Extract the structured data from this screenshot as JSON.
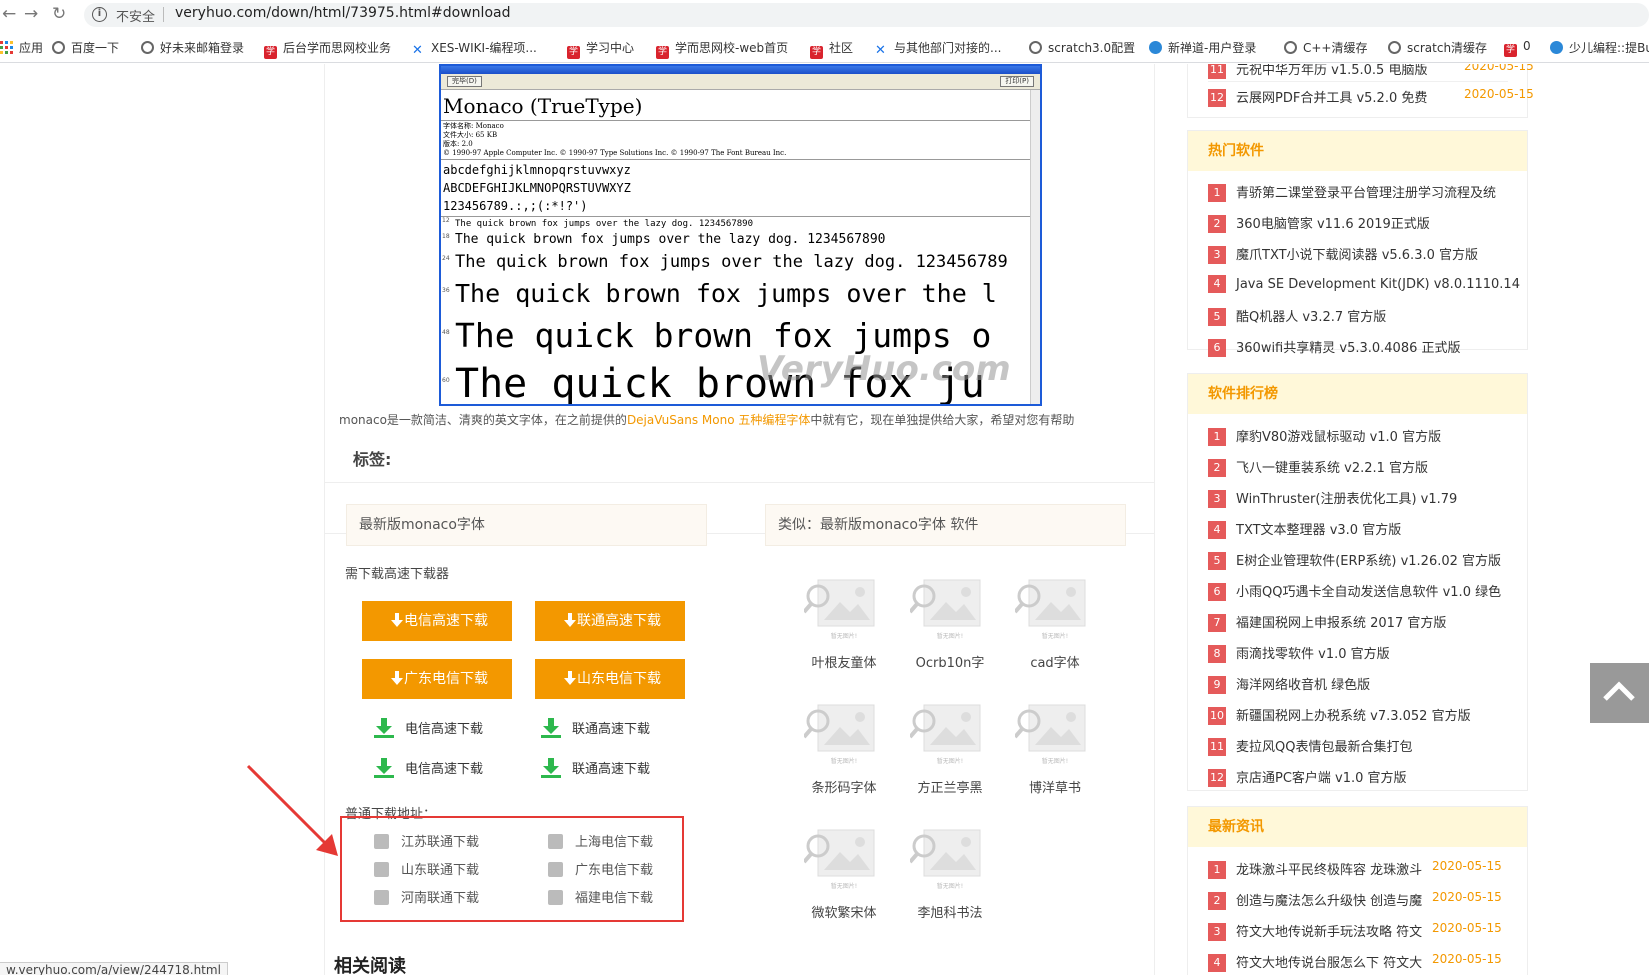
{
  "browser": {
    "insecure_label": "不安全",
    "url": "veryhuo.com/down/html/73975.html#download",
    "bookmarks": [
      "应用",
      "百度一下",
      "好未来邮箱登录",
      "后台学而思网校业务",
      "XES-WIKI-编程项...",
      "学习中心",
      "学而思网校-web首页",
      "社区",
      "与其他部门对接的...",
      "scratch3.0配置",
      "新禅道-用户登录",
      "C++清缓存",
      "scratch清缓存",
      "0",
      "少儿编程::提Bu"
    ],
    "xue_glyph": "学",
    "status_url": "w.veryhuo.com/a/view/244718.html"
  },
  "preview": {
    "toolbar_left": "完毕(D)",
    "toolbar_right": "打印(P)",
    "window_title": "Monaco (TrueType)",
    "font_name": "Monaco (TrueType)",
    "meta": [
      "字体名称: Monaco",
      "文件大小: 65 KB",
      "版本: 2.0",
      "© 1990-97 Apple Computer Inc. © 1990-97 Type Solutions Inc. © 1990-97 The Font Bureau Inc."
    ],
    "chars": [
      "abcdefghijklmnopqrstuvwxyz",
      "ABCDEFGHIJKLMNOPQRSTUVWXYZ",
      "123456789.:,;(:*!?')"
    ],
    "samples": [
      {
        "size": "12",
        "text": "The quick brown fox jumps over the lazy dog. 1234567890"
      },
      {
        "size": "18",
        "text": "The quick brown fox jumps over the lazy dog. 1234567890"
      },
      {
        "size": "24",
        "text": "The quick brown fox jumps over the lazy dog. 123456789"
      },
      {
        "size": "36",
        "text": "The quick brown fox jumps over the l"
      },
      {
        "size": "48",
        "text": "The quick brown fox jumps o"
      },
      {
        "size": "60",
        "text": "The quick brown fox ju"
      }
    ],
    "watermark": "VeryHuo.com"
  },
  "description": {
    "prefix": "monaco是一款简洁、清爽的英文字体，在之前提供的",
    "link": "DejaVuSans Mono 五种编程字体",
    "suffix": "中就有它，现在单独提供给大家，希望对您有帮助"
  },
  "tags_label": "标签:",
  "download": {
    "header": "最新版monaco字体",
    "similar_header": "类似：最新版monaco字体    软件",
    "need_label": "需下载高速下载器",
    "orange_buttons": [
      "电信高速下载",
      "联通高速下载",
      "广东电信下载",
      "山东电信下载"
    ],
    "green_links": [
      "电信高速下载",
      "联通高速下载",
      "电信高速下载",
      "联通高速下载"
    ],
    "normal_label": "普通下载地址：",
    "normal_links": [
      "江苏联通下载",
      "上海电信下载",
      "山东联通下载",
      "广东电信下载",
      "河南联通下载",
      "福建电信下载"
    ]
  },
  "similar": {
    "no_image_text": "暂无图片!",
    "items": [
      "叶根友童体",
      "Ocrb10n字",
      "cad字体",
      "条形码字体",
      "方正兰亭黑",
      "博洋草书",
      "微软繁宋体",
      "李旭科书法"
    ]
  },
  "related_reading": "相关阅读",
  "sidebar": {
    "top_items": [
      {
        "rank": "11",
        "name": "元祝中华万年历 v1.5.0.5 电脑版",
        "date": "2020-05-15"
      },
      {
        "rank": "12",
        "name": "云展网PDF合并工具 v5.2.0 免费",
        "date": "2020-05-15"
      }
    ],
    "hot_title": "热门软件",
    "hot_items": [
      {
        "rank": "1",
        "name": "青骄第二课堂登录平台管理注册学习流程及统"
      },
      {
        "rank": "2",
        "name": "360电脑管家 v11.6 2019正式版"
      },
      {
        "rank": "3",
        "name": "魔爪TXT小说下载阅读器 v5.6.3.0 官方版"
      },
      {
        "rank": "4",
        "name": "Java SE Development Kit(JDK) v8.0.1110.14"
      },
      {
        "rank": "5",
        "name": "酷Q机器人 v3.2.7 官方版"
      },
      {
        "rank": "6",
        "name": "360wifi共享精灵 v5.3.0.4086 正式版"
      }
    ],
    "rank_title": "软件排行榜",
    "rank_items": [
      {
        "rank": "1",
        "name": "摩豹V80游戏鼠标驱动 v1.0 官方版"
      },
      {
        "rank": "2",
        "name": "飞八一键重装系统 v2.2.1 官方版"
      },
      {
        "rank": "3",
        "name": "WinThruster(注册表优化工具) v1.79"
      },
      {
        "rank": "4",
        "name": "TXT文本整理器 v3.0 官方版"
      },
      {
        "rank": "5",
        "name": "E树企业管理软件(ERP系统) v1.26.02 官方版"
      },
      {
        "rank": "6",
        "name": "小雨QQ巧遇卡全自动发送信息软件 v1.0 绿色"
      },
      {
        "rank": "7",
        "name": "福建国税网上申报系统 2017 官方版"
      },
      {
        "rank": "8",
        "name": "雨滴找零软件 v1.0 官方版"
      },
      {
        "rank": "9",
        "name": "海洋网络收音机 绿色版"
      },
      {
        "rank": "10",
        "name": "新疆国税网上办税系统 v7.3.052 官方版"
      },
      {
        "rank": "11",
        "name": "麦拉风QQ表情包最新合集打包"
      },
      {
        "rank": "12",
        "name": "京店通PC客户端 v1.0 官方版"
      }
    ],
    "news_title": "最新资讯",
    "news_items": [
      {
        "rank": "1",
        "name": "龙珠激斗平民终极阵容 龙珠激斗",
        "date": "2020-05-15"
      },
      {
        "rank": "2",
        "name": "创造与魔法怎么升级快 创造与魔",
        "date": "2020-05-15"
      },
      {
        "rank": "3",
        "name": "符文大地传说新手玩法攻略 符文",
        "date": "2020-05-15"
      },
      {
        "rank": "4",
        "name": "符文大地传说台服怎么下 符文大",
        "date": "2020-05-15"
      }
    ]
  },
  "colors": {
    "accent_orange": "#f39800",
    "rank_red": "#e55a5a",
    "download_green": "#2db84d",
    "highlight_red": "#e53935"
  }
}
